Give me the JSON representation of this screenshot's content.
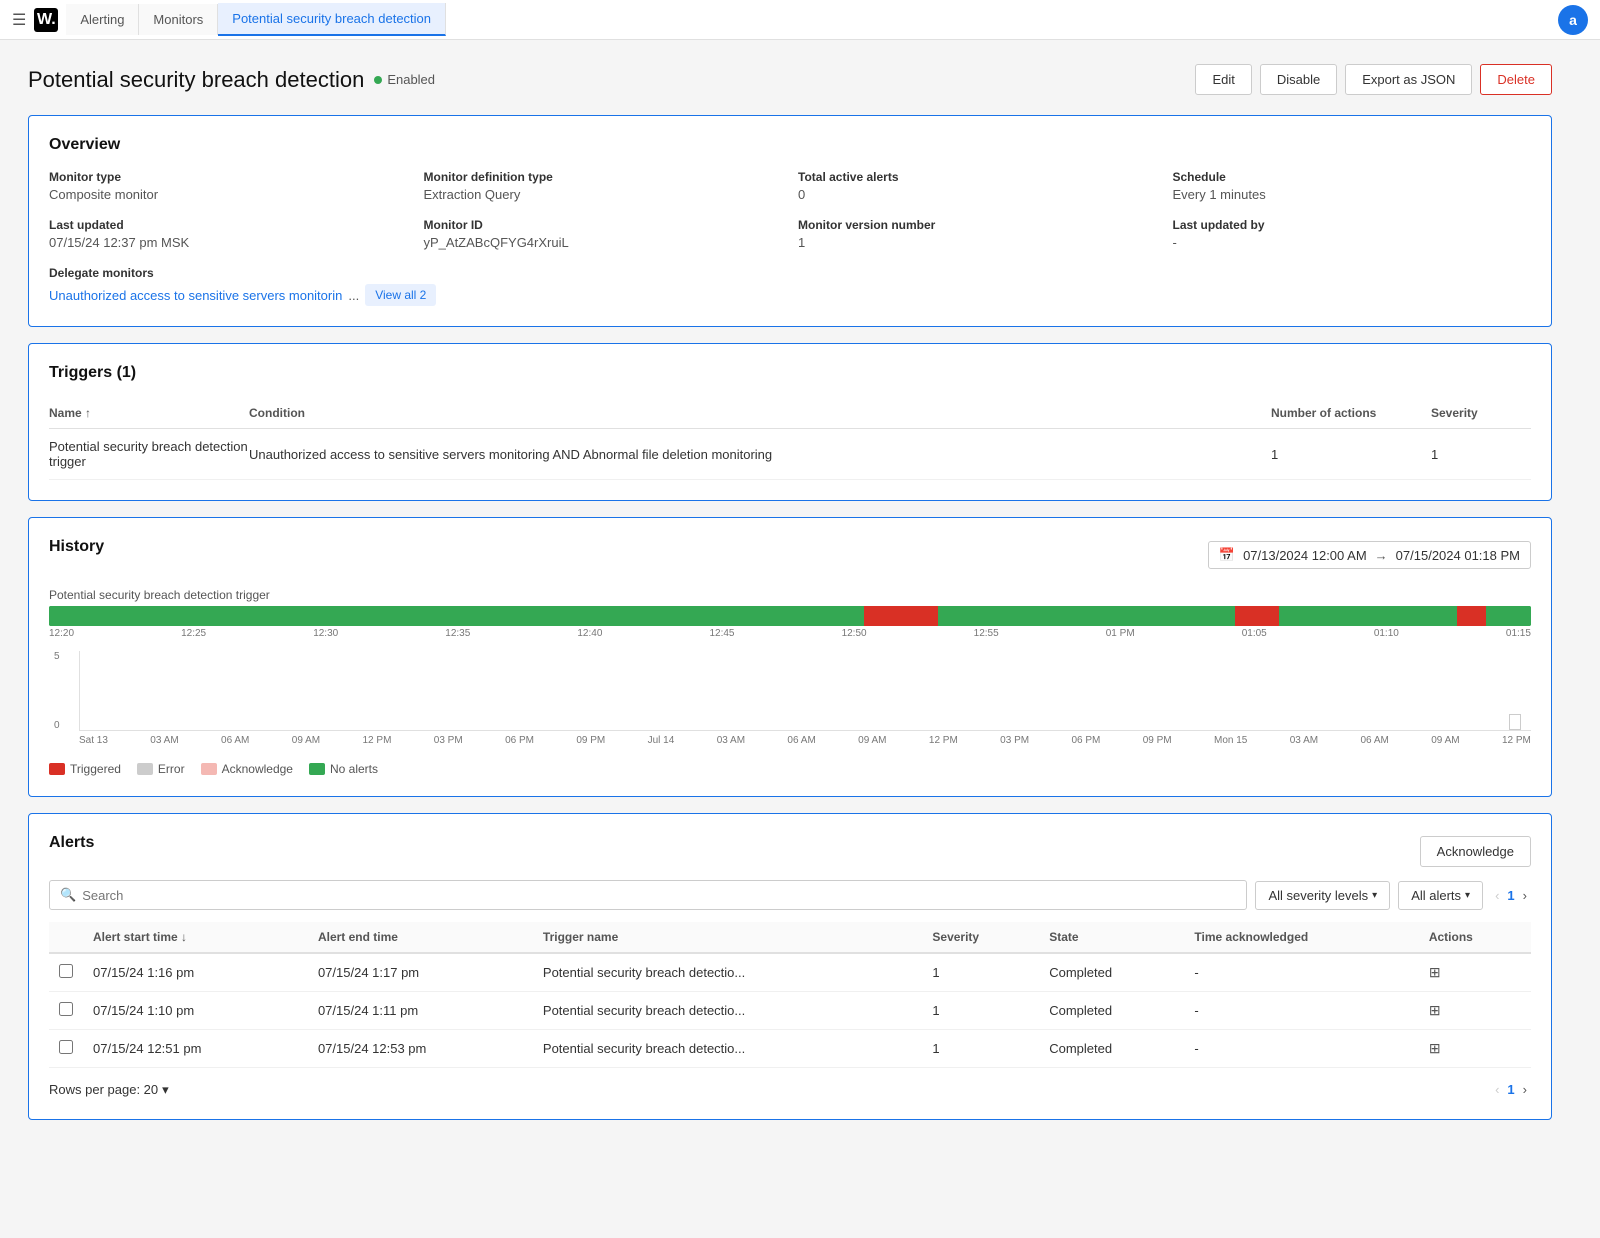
{
  "nav": {
    "hamburger": "☰",
    "logo": "W.",
    "breadcrumbs": [
      {
        "label": "Alerting",
        "active": false
      },
      {
        "label": "Monitors",
        "active": false
      },
      {
        "label": "Potential security breach detection",
        "active": true
      }
    ],
    "avatar_label": "a"
  },
  "page": {
    "title": "Potential security breach detection",
    "status": "Enabled",
    "actions": {
      "edit": "Edit",
      "disable": "Disable",
      "export": "Export as JSON",
      "delete": "Delete"
    }
  },
  "overview": {
    "section_title": "Overview",
    "fields": [
      {
        "label": "Monitor type",
        "value": "Composite monitor"
      },
      {
        "label": "Monitor definition type",
        "value": "Extraction Query"
      },
      {
        "label": "Total active alerts",
        "value": "0"
      },
      {
        "label": "Schedule",
        "value": "Every 1 minutes"
      },
      {
        "label": "Last updated",
        "value": "07/15/24 12:37 pm MSK"
      },
      {
        "label": "Monitor ID",
        "value": "yP_AtZABcQFYG4rXruiL"
      },
      {
        "label": "Monitor version number",
        "value": "1"
      },
      {
        "label": "Last updated by",
        "value": "-"
      }
    ],
    "delegate_label": "Delegate monitors",
    "delegate_link": "Unauthorized access to sensitive servers monitorin",
    "delegate_ellipsis": "...",
    "view_all_btn": "View all 2"
  },
  "triggers": {
    "section_title": "Triggers (1)",
    "columns": [
      {
        "label": "Name ↑"
      },
      {
        "label": "Condition"
      },
      {
        "label": "Number of actions"
      },
      {
        "label": "Severity"
      }
    ],
    "rows": [
      {
        "name": "Potential security breach detection trigger",
        "condition": "Unauthorized access to sensitive servers monitoring AND Abnormal file deletion monitoring",
        "num_actions": "1",
        "severity": "1"
      }
    ]
  },
  "history": {
    "section_title": "History",
    "date_from": "07/13/2024 12:00 AM",
    "date_to": "07/15/2024 01:18 PM",
    "trigger_label": "Potential security breach detection trigger",
    "timeline_ticks": [
      "12:20",
      "12:25",
      "12:30",
      "12:35",
      "12:40",
      "12:45",
      "12:50",
      "12:55",
      "01 PM",
      "01:05",
      "01:10",
      "01:15"
    ],
    "chart_y_labels": [
      "5",
      "0"
    ],
    "chart_x_labels": [
      "Sat 13",
      "03 AM",
      "06 AM",
      "09 AM",
      "12 PM",
      "03 PM",
      "06 PM",
      "09 PM",
      "Jul 14",
      "03 AM",
      "06 AM",
      "09 AM",
      "12 PM",
      "03 PM",
      "06 PM",
      "09 PM",
      "Mon 15",
      "03 AM",
      "06 AM",
      "09 AM",
      "12 PM"
    ],
    "legend": [
      {
        "label": "Triggered",
        "color": "#d93025"
      },
      {
        "label": "Error",
        "color": "#ccc"
      },
      {
        "label": "Acknowledge",
        "color": "#f4b8b3"
      },
      {
        "label": "No alerts",
        "color": "#34a853"
      }
    ]
  },
  "alerts": {
    "section_title": "Alerts",
    "acknowledge_btn": "Acknowledge",
    "search_placeholder": "Search",
    "filter_severity": "All severity levels",
    "filter_alerts": "All alerts",
    "pagination": {
      "current": "1",
      "prev_disabled": true,
      "next_disabled": false
    },
    "columns": [
      {
        "label": ""
      },
      {
        "label": "Alert start time ↓"
      },
      {
        "label": "Alert end time"
      },
      {
        "label": "Trigger name"
      },
      {
        "label": "Severity"
      },
      {
        "label": "State"
      },
      {
        "label": "Time acknowledged"
      },
      {
        "label": "Actions"
      }
    ],
    "rows": [
      {
        "start": "07/15/24 1:16 pm",
        "end": "07/15/24 1:17 pm",
        "trigger": "Potential security breach detectio...",
        "severity": "1",
        "state": "Completed",
        "acknowledged": "-"
      },
      {
        "start": "07/15/24 1:10 pm",
        "end": "07/15/24 1:11 pm",
        "trigger": "Potential security breach detectio...",
        "severity": "1",
        "state": "Completed",
        "acknowledged": "-"
      },
      {
        "start": "07/15/24 12:51 pm",
        "end": "07/15/24 12:53 pm",
        "trigger": "Potential security breach detectio...",
        "severity": "1",
        "state": "Completed",
        "acknowledged": "-"
      }
    ],
    "rows_per_page_label": "Rows per page: 20",
    "footer_page": "1"
  }
}
